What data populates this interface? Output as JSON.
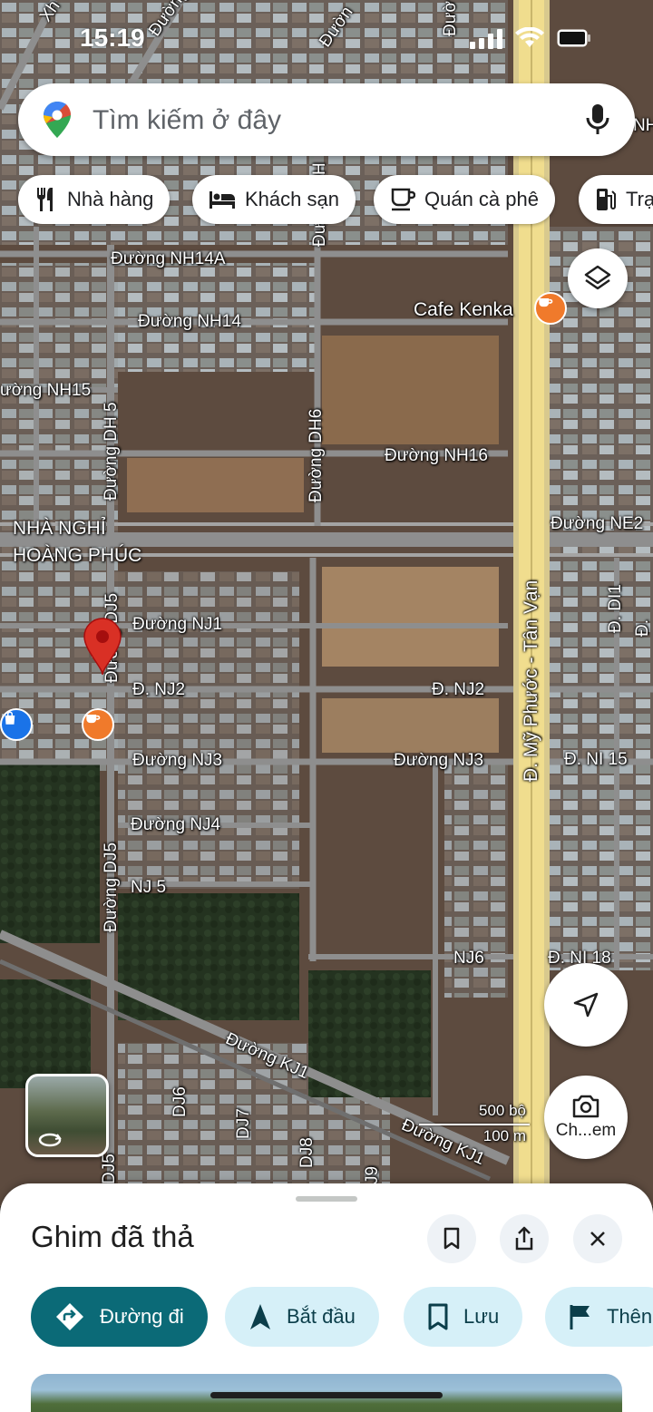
{
  "status_bar": {
    "time": "15:19"
  },
  "search": {
    "placeholder": "Tìm kiếm ở đây",
    "icon": "google-maps-pin-icon",
    "mic_icon": "mic-icon"
  },
  "chips": [
    {
      "label": "Nhà hàng",
      "icon": "restaurant-icon"
    },
    {
      "label": "Khách sạn",
      "icon": "hotel-icon"
    },
    {
      "label": "Quán cà phê",
      "icon": "coffee-icon"
    },
    {
      "label": "Trạ",
      "icon": "gas-station-icon"
    }
  ],
  "map": {
    "roads": {
      "nh14a": "Đường NH14A",
      "nh14": "Đường NH14",
      "nh15": "ường NH15",
      "dh5": "Đường DH 5",
      "dh6": "Đường DH6",
      "dh_top": "Đường DH",
      "kh_top": "Đường KH",
      "nh16": "Đường NH16",
      "ne2": "Đường NE2",
      "nj1": "Đường NJ1",
      "nj2_left": "Đ. NJ2",
      "nj2_right": "Đ. NJ2",
      "nj3_left": "Đường NJ3",
      "nj3_right": "Đường NJ3",
      "nj4": "Đường NJ4",
      "nj5": "NJ 5",
      "nj6": "NJ6",
      "dj5_upper": "Đường DJ5",
      "dj5_lower": "Đường DJ5",
      "my_phuoc": "Đ. Mỹ Phước - Tân Vạn",
      "ni15": "Đ. NI 15",
      "ni18": "Đ. NI 18",
      "di1": "Đ. DI1",
      "d_right": "Đ.",
      "kj1": "Đường KJ1",
      "kj1_lower": "Đường KJ1",
      "dj6": "DJ6",
      "dj7": "DJ7",
      "dj8": "DJ8",
      "dj_bottom": "DJ5",
      "j9": "J9",
      "top_left_fragment": "Xh",
      "top_mid_fragment": "Đườn",
      "top_right_fragment": "Đườ",
      "nh_right_fragment": "NH"
    },
    "places": {
      "cafe": "Cafe Kenka",
      "guesthouse_line1": "NHÀ NGHỈ",
      "guesthouse_line2": "HOÀNG PHÚC"
    },
    "scale": {
      "imperial": "500 bộ",
      "metric": "100 m"
    },
    "pin_color": "#d93025",
    "cafe_pin_color": "#f07a2b",
    "shop_pin_color": "#1a73e8"
  },
  "controls": {
    "layers_icon": "layers-icon",
    "my_location_icon": "navigation-arrow-icon",
    "lens_label": "Ch...em",
    "street_view_icon": "street-view-rotate-icon"
  },
  "sheet": {
    "title": "Ghim đã thả",
    "icons": [
      "bookmark-icon",
      "share-icon",
      "close-icon"
    ],
    "actions": [
      {
        "label": "Đường đi",
        "icon": "directions-icon"
      },
      {
        "label": "Bắt đầu",
        "icon": "navigate-arrow-icon"
      },
      {
        "label": "Lưu",
        "icon": "bookmark-icon"
      },
      {
        "label": "Thên",
        "icon": "flag-icon"
      }
    ],
    "accent": "#0b6a77",
    "chip_bg": "#d6f0f8"
  }
}
